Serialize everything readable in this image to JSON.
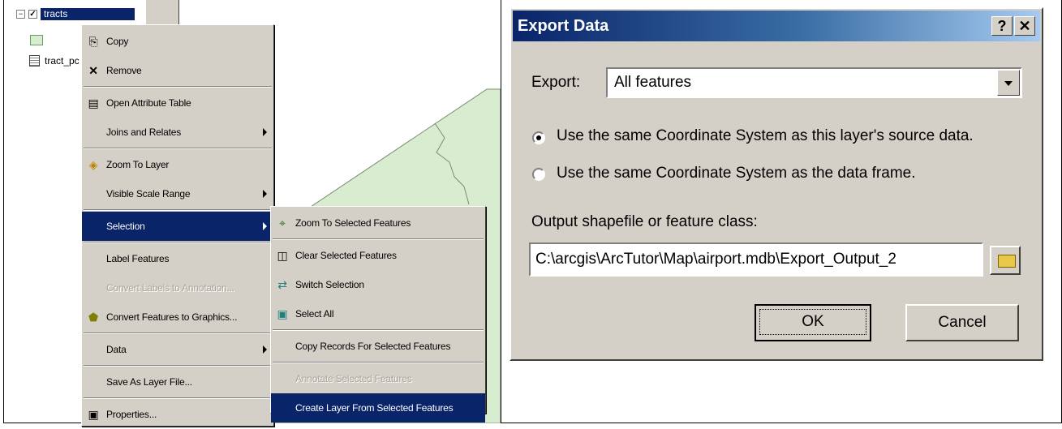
{
  "toc": {
    "layer1_label": "tracts",
    "layer2_label": "tract_pc",
    "collapse_symbol": "−",
    "check_symbol": "✓"
  },
  "context_menu": {
    "items": [
      {
        "label": "Copy",
        "icon": "copy-icon"
      },
      {
        "label": "Remove",
        "icon": "remove-icon"
      },
      {
        "label": "Open Attribute Table",
        "icon": "table-icon"
      },
      {
        "label": "Joins and Relates",
        "submenu": true
      },
      {
        "label": "Zoom To Layer",
        "icon": "zoom-layer-icon"
      },
      {
        "label": "Visible Scale Range",
        "submenu": true
      },
      {
        "label": "Selection",
        "submenu": true,
        "selected": true
      },
      {
        "label": "Label Features"
      },
      {
        "label": "Convert Labels to Annotation...",
        "disabled": true
      },
      {
        "label": "Convert Features to Graphics...",
        "icon": "convert-graphics-icon"
      },
      {
        "label": "Data",
        "submenu": true
      },
      {
        "label": "Save As Layer File..."
      },
      {
        "label": "Properties...",
        "icon": "properties-icon"
      }
    ]
  },
  "selection_submenu": {
    "items": [
      {
        "label": "Zoom To Selected Features",
        "icon": "zoom-selected-icon"
      },
      {
        "label": "Clear Selected Features",
        "icon": "clear-selection-icon"
      },
      {
        "label": "Switch Selection",
        "icon": "switch-selection-icon"
      },
      {
        "label": "Select All",
        "icon": "select-all-icon"
      },
      {
        "label": "Copy Records For Selected Features"
      },
      {
        "label": "Annotate Selected Features",
        "disabled": true
      },
      {
        "label": "Create Layer From Selected Features",
        "selected": true
      }
    ]
  },
  "dialog": {
    "title": "Export Data",
    "help_symbol": "?",
    "close_symbol": "✕",
    "export_label": "Export:",
    "export_value": "All features",
    "radio1_label": "Use the same Coordinate System as this layer's source data.",
    "radio2_label": "Use the same Coordinate System as the data frame.",
    "output_label": "Output shapefile or feature class:",
    "output_value": "C:\\arcgis\\ArcTutor\\Map\\airport.mdb\\Export_Output_2",
    "ok_label": "OK",
    "cancel_label": "Cancel"
  },
  "colors": {
    "highlight": "#0a246a",
    "dialog_face": "#d4d0c8",
    "map_fill": "#d8ecd0"
  }
}
